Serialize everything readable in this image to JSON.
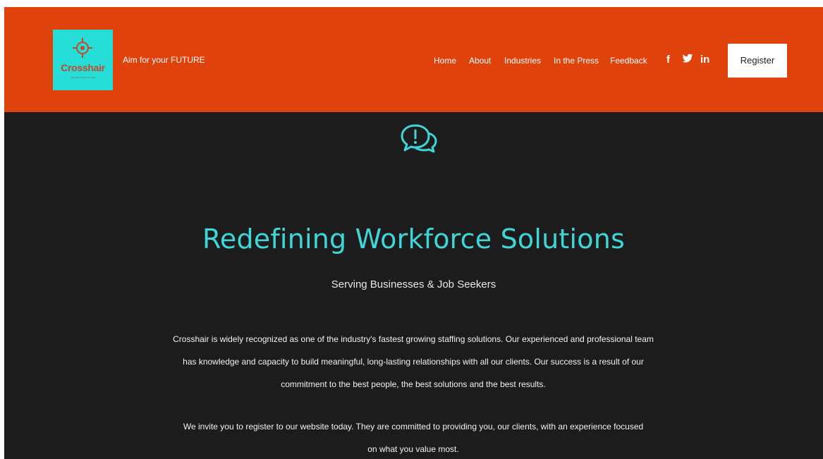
{
  "header": {
    "logo_text": "Crosshair",
    "logo_subtext": "AIM FOR YOUR FUTURE",
    "tagline": "Aim for your FUTURE",
    "nav": [
      "Home",
      "About",
      "Industries",
      "In the Press",
      "Feedback"
    ],
    "social": {
      "facebook": "f",
      "twitter": "🐦",
      "linkedin": "in"
    },
    "register_label": "Register"
  },
  "main": {
    "icon": "chat-bubbles-icon",
    "title": "Redefining Workforce Solutions",
    "subtitle": "Serving Businesses & Job Seekers",
    "paragraph1": "Crosshair is widely recognized as one of the industry's fastest growing staffing solutions. Our experienced and professional team has knowledge and capacity to build meaningful, long-lasting relationships with all our clients. Our success is a result of our commitment to the best people, the best solutions and the best results.",
    "paragraph2": "We invite you to register to our website today. They are committed to providing you, our clients, with an experience focused on what you value most."
  },
  "colors": {
    "header_bg": "#e0420c",
    "body_bg": "#1c1c1c",
    "accent": "#3fd6d8",
    "logo_bg": "#27ddd7"
  }
}
